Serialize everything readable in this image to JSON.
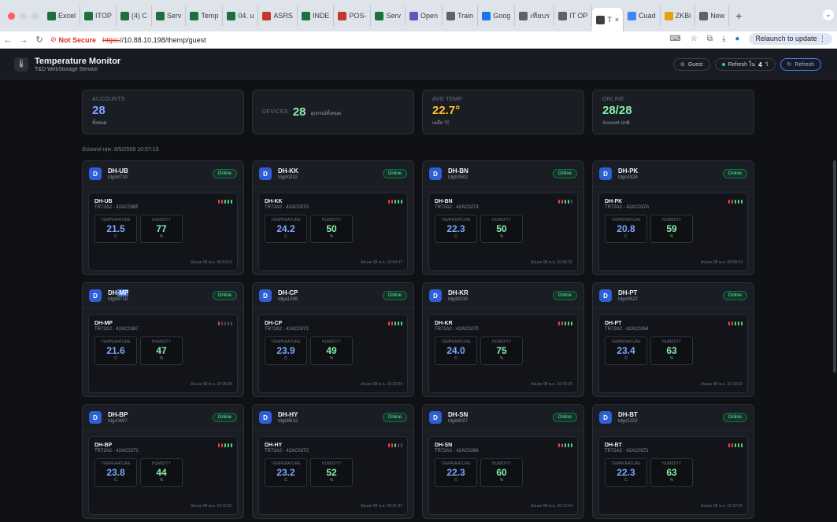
{
  "browser": {
    "tabs": [
      {
        "label": "Excel",
        "color": "#1d6f42"
      },
      {
        "label": "ITOP",
        "color": "#1d6f42"
      },
      {
        "label": "(4) C",
        "color": "#1d6f42"
      },
      {
        "label": "Serv",
        "color": "#1d6f42"
      },
      {
        "label": "Temp",
        "color": "#1d6f42"
      },
      {
        "label": "04. u",
        "color": "#1d6f42"
      },
      {
        "label": "ASRS",
        "color": "#c0392b"
      },
      {
        "label": "INDE",
        "color": "#1d6f42"
      },
      {
        "label": "POS-",
        "color": "#c0392b"
      },
      {
        "label": "Serv",
        "color": "#1d6f42"
      },
      {
        "label": "Open",
        "color": "#6b4fbb"
      },
      {
        "label": "Train",
        "color": "#5f6368"
      },
      {
        "label": "Goog",
        "color": "#1a73e8"
      },
      {
        "label": "เทียบร",
        "color": "#5f6368"
      },
      {
        "label": "IT OP",
        "color": "#5f6368"
      }
    ],
    "active_tab": "T",
    "tabs_after": [
      {
        "label": "Cuad",
        "color": "#4285f4"
      },
      {
        "label": "ZKBi",
        "color": "#e5a00d"
      },
      {
        "label": "New",
        "color": "#5f6368"
      }
    ],
    "not_secure": "Not Secure",
    "url_scheme": "https:",
    "url_rest": "//10.88.10.198/themp/guest",
    "relaunch": "Relaunch to update"
  },
  "header": {
    "title": "Temperature Monitor",
    "subtitle": "T&D WebStorage Service",
    "guest": "Guest",
    "refresh_in_label": "Refresh ใน",
    "refresh_in_value": "4",
    "refresh_in_unit": "วิ",
    "refresh_btn": "Refresh"
  },
  "stats": {
    "accounts": {
      "label": "ACCOUNTS",
      "value": "28",
      "sub": "ทั้งหมด"
    },
    "devices": {
      "label": "DEVICES",
      "value": "28",
      "sub": "อุปกรณ์ทั้งหมด"
    },
    "avg_temp": {
      "label": "AVG TEMP",
      "value": "22.7°",
      "sub": "เฉลี่ย °C"
    },
    "online": {
      "label": "ONLINE",
      "value": "28/28",
      "sub": "Account ปกติ"
    }
  },
  "updated": "อัปเดตล่าสุด: 8/5/2569 10:57:13",
  "labels": {
    "temperature": "TEMPERATURE",
    "humidity": "HUMIDITY",
    "temp_unit": "C",
    "hum_unit": "%",
    "online": "Online",
    "badge": "D"
  },
  "colors": {
    "signal_on": "#ef4444",
    "signal_good": "#4ade80",
    "signal_off": "#4b5060"
  },
  "devices": [
    {
      "name": "DH-UB",
      "id": "tdgb8730",
      "model": "TR72A2 - 42AC038F",
      "temp": "21.5",
      "hum": "77",
      "signal": 5,
      "ts": "อัปเดต 08 พ.ค. 09:54:15"
    },
    {
      "name": "DH-KK",
      "id": "tdgb0332",
      "model": "TR72A2 - 42AC0370",
      "temp": "24.2",
      "hum": "50",
      "signal": 5,
      "ts": "อัปเดต 08 พ.ค. 10:04:47"
    },
    {
      "name": "DH-BN",
      "id": "tdgb3582",
      "model": "TR72A2 - 42AC0273",
      "temp": "22.3",
      "hum": "50",
      "signal": 4,
      "ts": "อัปเดต 08 พ.ค. 10:56:20"
    },
    {
      "name": "DH-PK",
      "id": "tdgc4928",
      "model": "TR72A2 - 42AC037A",
      "temp": "20.8",
      "hum": "59",
      "signal": 5,
      "ts": "อัปเดต 08 พ.ค. 09:58:13"
    },
    {
      "name": "DH-MP",
      "id": "tdgb9718",
      "model": "TR72A2 - 42AC0267",
      "temp": "21.6",
      "hum": "47",
      "signal": 1,
      "ts": "อัปเดต 08 พ.ค. 10:36:38"
    },
    {
      "name": "DH-CP",
      "id": "tdga1388",
      "model": "TR72A2 - 42AC0372",
      "temp": "23.9",
      "hum": "49",
      "signal": 5,
      "ts": "อัปเดต 08 พ.ค. 10:20:04"
    },
    {
      "name": "DH-KR",
      "id": "tdgd8236",
      "model": "TR72A2 - 42AC0270",
      "temp": "24.0",
      "hum": "75",
      "signal": 5,
      "ts": "อัปเดต 08 พ.ค. 10:42:25"
    },
    {
      "name": "DH-PT",
      "id": "tdgc8622",
      "model": "TR72A2 - 42AC0264",
      "temp": "23.4",
      "hum": "63",
      "signal": 5,
      "ts": "อัปเดต 08 พ.ค. 10:18:32"
    },
    {
      "name": "DH-BP",
      "id": "tdgc0497",
      "model": "TR72A2 - 42AC0271",
      "temp": "23.8",
      "hum": "44",
      "signal": 5,
      "ts": "อัปเดต 08 พ.ค. 10:15:37"
    },
    {
      "name": "DH-HY",
      "id": "tdgb9612",
      "model": "TR72A2 - 42AC037C",
      "temp": "23.2",
      "hum": "52",
      "signal": 3,
      "ts": "อัปเดต 08 พ.ค. 09:21:47"
    },
    {
      "name": "DH-SN",
      "id": "tdgb8597",
      "model": "TR72A2 - 42AC0266",
      "temp": "22.3",
      "hum": "60",
      "signal": 5,
      "ts": "อัปเดต 08 พ.ค. 10:13:44"
    },
    {
      "name": "DH-BT",
      "id": "tdgc5152",
      "model": "TR72A2 - 42AC0371",
      "temp": "22.3",
      "hum": "63",
      "signal": 5,
      "ts": "อัปเดต 08 พ.ค. 10:37:26"
    }
  ]
}
